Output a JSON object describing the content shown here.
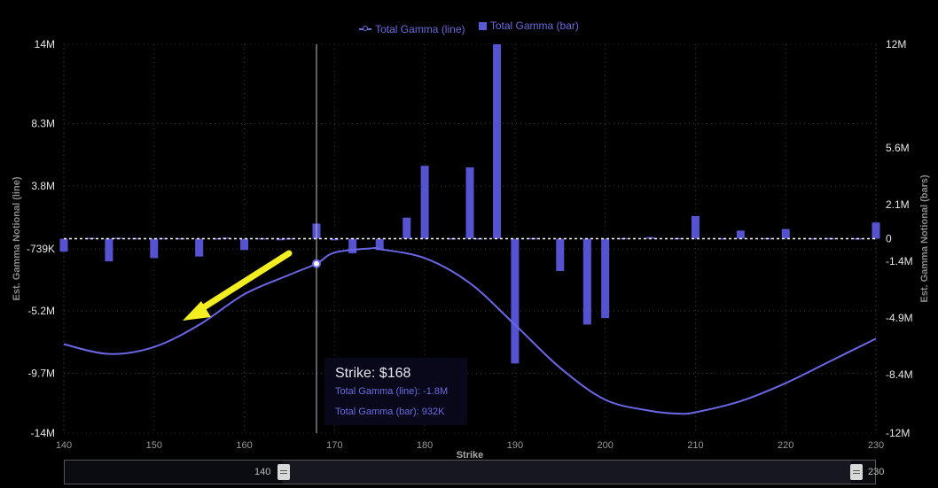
{
  "legend": {
    "line": "Total Gamma (line)",
    "bar": "Total Gamma (bar)"
  },
  "tooltip": {
    "title": "Strike: $168",
    "line": "Total Gamma (line): -1.8M",
    "bar": "Total Gamma (bar): 932K"
  },
  "slider": {
    "min_label": "140",
    "max_label": "230"
  },
  "colors": {
    "line": "#6a67e6",
    "bar": "#5553d0",
    "arrow": "#f2ee20",
    "zero_line": "#ffffff"
  },
  "chart_data": {
    "type": "bar",
    "xlabel": "Strike",
    "ylabel_left": "Est. Gamma Notional (line)",
    "ylabel_right": "Est. Gamma Notional (bars)",
    "xlim": [
      140,
      230
    ],
    "x_ticks": [
      140,
      150,
      160,
      170,
      180,
      190,
      200,
      210,
      220,
      230
    ],
    "ylim_left": [
      -14000000,
      14000000
    ],
    "ylim_right": [
      -12000000,
      12000000
    ],
    "y_ticks_left": [
      {
        "v": 14000000,
        "label": "14M"
      },
      {
        "v": 8300000,
        "label": "8.3M"
      },
      {
        "v": 3800000,
        "label": "3.8M"
      },
      {
        "v": -739000,
        "label": "-739K"
      },
      {
        "v": -5200000,
        "label": "-5.2M"
      },
      {
        "v": -9700000,
        "label": "-9.7M"
      },
      {
        "v": -14000000,
        "label": "-14M"
      }
    ],
    "y_ticks_right": [
      {
        "v": 12000000,
        "label": "12M"
      },
      {
        "v": 5600000,
        "label": "5.6M"
      },
      {
        "v": 2100000,
        "label": "2.1M"
      },
      {
        "v": 0,
        "label": "0"
      },
      {
        "v": -1400000,
        "label": "-1.4M"
      },
      {
        "v": -4900000,
        "label": "-4.9M"
      },
      {
        "v": -8400000,
        "label": "-8.4M"
      },
      {
        "v": -12000000,
        "label": "-12M"
      }
    ],
    "series": [
      {
        "name": "Total Gamma (bar)",
        "type": "bar",
        "axis": "right",
        "x": [
          140,
          143,
          145,
          146,
          148,
          150,
          151,
          153,
          155,
          157,
          158,
          160,
          162,
          164,
          165,
          168,
          170,
          172,
          175,
          178,
          180,
          183,
          185,
          186,
          188,
          190,
          192,
          195,
          198,
          200,
          202,
          205,
          208,
          210,
          213,
          215,
          218,
          220,
          223,
          225,
          228,
          230
        ],
        "values": [
          -800000,
          50000,
          -1400000,
          60000,
          40000,
          -1200000,
          40000,
          30000,
          -1100000,
          30000,
          70000,
          -700000,
          30000,
          -100000,
          30000,
          932000,
          -100000,
          -900000,
          -700000,
          1300000,
          4500000,
          30000,
          4400000,
          30000,
          12000000,
          -7700000,
          40000,
          -2000000,
          -5300000,
          -4900000,
          40000,
          100000,
          40000,
          1400000,
          30000,
          500000,
          40000,
          600000,
          30000,
          40000,
          30000,
          1000000
        ]
      },
      {
        "name": "Total Gamma (line)",
        "type": "line",
        "axis": "left",
        "x": [
          140,
          145,
          150,
          155,
          160,
          165,
          168,
          170,
          174,
          175,
          180,
          185,
          190,
          195,
          200,
          205,
          208,
          210,
          215,
          220,
          225,
          230
        ],
        "values": [
          -7600000,
          -8300000,
          -7800000,
          -6200000,
          -4000000,
          -2600000,
          -1800000,
          -1000000,
          -700000,
          -750000,
          -1400000,
          -3200000,
          -6200000,
          -9300000,
          -11600000,
          -12400000,
          -12600000,
          -12500000,
          -11700000,
          -10400000,
          -8800000,
          -7200000
        ]
      }
    ],
    "crosshair_x": 168,
    "tooltip_x": 168
  }
}
